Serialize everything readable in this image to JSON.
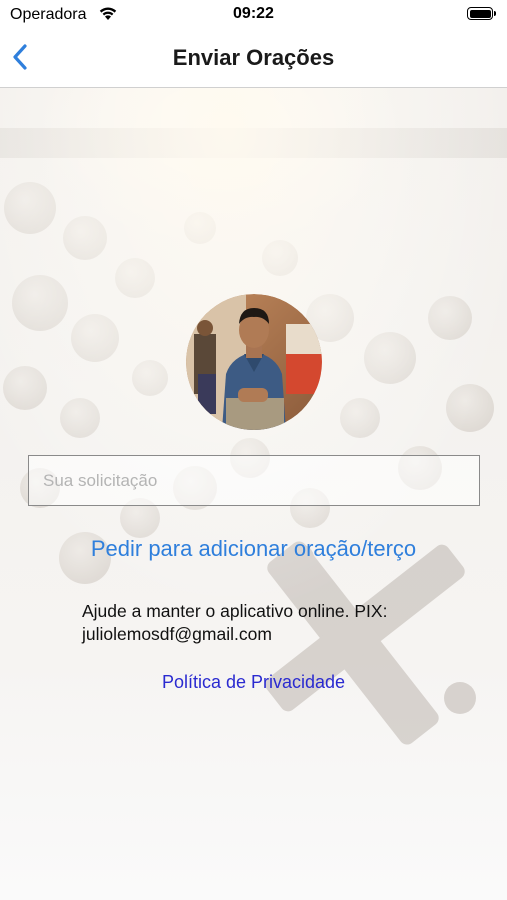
{
  "status_bar": {
    "carrier": "Operadora",
    "time": "09:22",
    "icons": [
      "wifi-icon",
      "battery-icon"
    ]
  },
  "nav": {
    "back_icon": "chevron-left-icon",
    "title": "Enviar Orações"
  },
  "form": {
    "request_placeholder": "Sua solicitação",
    "request_value": "",
    "submit_label": "Pedir para adicionar oração/terço"
  },
  "donation": {
    "text": "Ajude a manter o aplicativo online. PIX: juliolemosdf@gmail.com"
  },
  "links": {
    "privacy": "Política de Privacidade"
  },
  "colors": {
    "accent": "#2f7fdc",
    "link": "#2a2ad0",
    "text": "#111111"
  }
}
